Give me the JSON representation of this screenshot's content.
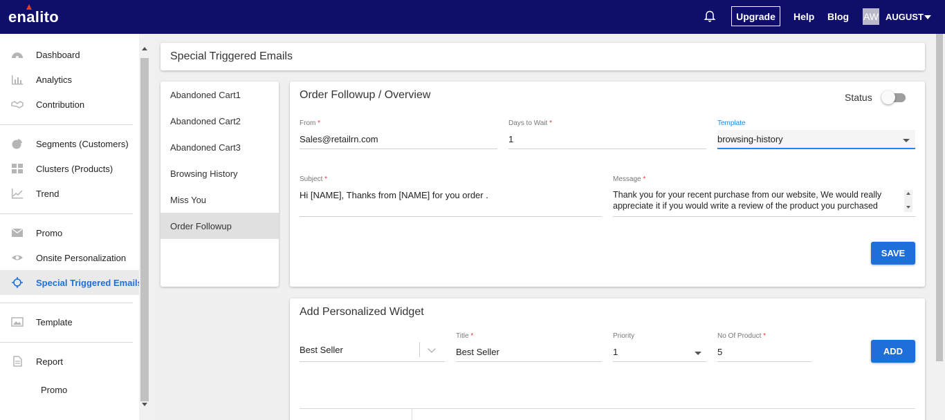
{
  "topbar": {
    "logo": "enalito",
    "upgrade": "Upgrade",
    "help": "Help",
    "blog": "Blog",
    "avatar_initials": "AW",
    "username": "AUGUST",
    "bg_color": "#0f0f6b"
  },
  "sidebar": {
    "items": [
      {
        "label": "Dashboard",
        "icon": "dashboard-icon"
      },
      {
        "label": "Analytics",
        "icon": "analytics-icon"
      },
      {
        "label": "Contribution",
        "icon": "handshake-icon"
      },
      {
        "label": "Segments (Customers)",
        "icon": "pie-chart-icon"
      },
      {
        "label": "Clusters (Products)",
        "icon": "grid-icon"
      },
      {
        "label": "Trend",
        "icon": "trend-icon"
      },
      {
        "label": "Promo",
        "icon": "mail-icon"
      },
      {
        "label": "Onsite Personalization",
        "icon": "eye-icon"
      },
      {
        "label": "Special Triggered Emails",
        "icon": "crosshair-icon",
        "active": true
      },
      {
        "label": "Template",
        "icon": "image-icon"
      },
      {
        "label": "Report",
        "icon": "document-icon"
      }
    ],
    "sub_items": [
      "Promo"
    ],
    "active_color": "#1e6fd9"
  },
  "page": {
    "title": "Special Triggered Emails"
  },
  "email_list": {
    "items": [
      "Abandoned Cart1",
      "Abandoned Cart2",
      "Abandoned Cart3",
      "Browsing History",
      "Miss You",
      "Order Followup"
    ],
    "active": "Order Followup"
  },
  "overview": {
    "title": "Order Followup / Overview",
    "status_label": "Status",
    "status_on": false,
    "from_label": "From",
    "from_value": "Sales@retailrn.com",
    "days_label": "Days to Wait",
    "days_value": "1",
    "template_label": "Template",
    "template_value": "browsing-history",
    "subject_label": "Subject",
    "subject_value": "Hi [NAME], Thanks from [NAME] for you order .",
    "message_label": "Message",
    "message_line1": "Thank you for your recent purchase from our website, We would really",
    "message_line2": "appreciate it if you would write a review of the product you purchased",
    "save_label": "SAVE",
    "required_mark": "*"
  },
  "widget": {
    "title": "Add Personalized Widget",
    "type_value": "Best Seller",
    "title_label": "Title",
    "title_value": "Best Seller",
    "priority_label": "Priority",
    "priority_value": "1",
    "count_label": "No Of Product",
    "count_value": "5",
    "add_label": "ADD"
  },
  "button_color": "#1e6fd9"
}
